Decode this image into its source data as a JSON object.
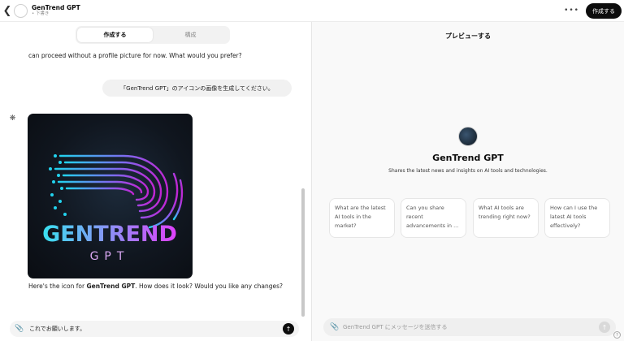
{
  "topbar": {
    "title": "GenTrend GPT",
    "status": "• 下書き",
    "more_label": "•••",
    "create_button": "作成する"
  },
  "tabs": [
    {
      "label": "作成する",
      "active": true
    },
    {
      "label": "構成",
      "active": false
    }
  ],
  "chat": {
    "previous_message": "can proceed without a profile picture for now. What would you prefer?",
    "user_message": "「GenTrend GPT」のアイコンの画像を生成してください。",
    "image_text": {
      "line1": "GENTREND",
      "line2": "GPT"
    },
    "reply_prefix": "Here's the icon for ",
    "reply_bold": "GenTrend GPT",
    "reply_suffix": ". How does it look? Would you like any changes?",
    "composer_value": "これでお願いします。"
  },
  "preview": {
    "title": "プレビューする",
    "name": "GenTrend GPT",
    "description": "Shares the latest news and insights on AI tools and technologies.",
    "starters": [
      "What are the latest AI tools in the market?",
      "Can you share recent advancements in ...",
      "What AI tools are trending right now?",
      "How can I use the latest AI tools effectively?"
    ],
    "composer_placeholder": "GenTrend GPT にメッセージを送信する"
  },
  "colors": {
    "accent_dark": "#0d0d0d",
    "logo_cyan": "#22d3ee",
    "logo_magenta": "#c026d3"
  }
}
